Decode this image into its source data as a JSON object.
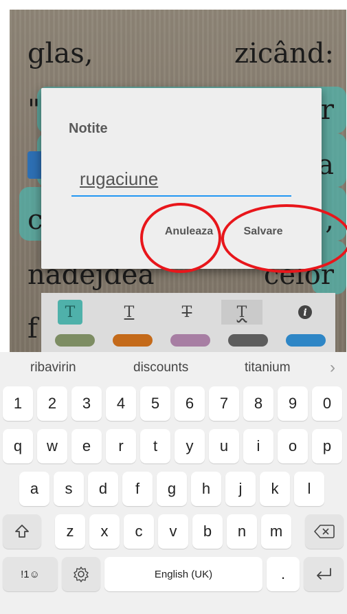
{
  "reader": {
    "line1_left": "glas,",
    "line1_right": "zicând:",
    "line2_left": "\"",
    "line2_right": "r",
    "line3_right": "a",
    "line4_left": "c",
    "line4_right": ",",
    "line5_left": "nadejdea",
    "line5_right": "celor",
    "line6_left": "f"
  },
  "dialog": {
    "title": "Notite",
    "input_value": "rugaciune",
    "cancel_label": "Anuleaza",
    "save_label": "Salvare"
  },
  "format_toolbar": {
    "icons": [
      "T",
      "T",
      "T",
      "T",
      "i"
    ],
    "swatch_colors": [
      "#7d8d63",
      "#c46a1a",
      "#a77ea3",
      "#5d5d5d",
      "#2e86c6"
    ]
  },
  "keyboard": {
    "suggestions": [
      "ribavirin",
      "discounts",
      "titanium"
    ],
    "suggest_more": "›",
    "row_numbers": [
      "1",
      "2",
      "3",
      "4",
      "5",
      "6",
      "7",
      "8",
      "9",
      "0"
    ],
    "row_q": [
      "q",
      "w",
      "e",
      "r",
      "t",
      "y",
      "u",
      "i",
      "o",
      "p"
    ],
    "row_a": [
      "a",
      "s",
      "d",
      "f",
      "g",
      "h",
      "j",
      "k",
      "l"
    ],
    "row_z": [
      "z",
      "x",
      "c",
      "v",
      "b",
      "n",
      "m"
    ],
    "symbols_label": "!1☺",
    "space_label": "English (UK)",
    "period_label": "."
  },
  "colors": {
    "accent_blue": "#2196f3",
    "highlight_teal": "#4fb1aa",
    "annotation_red": "#e8161b"
  }
}
